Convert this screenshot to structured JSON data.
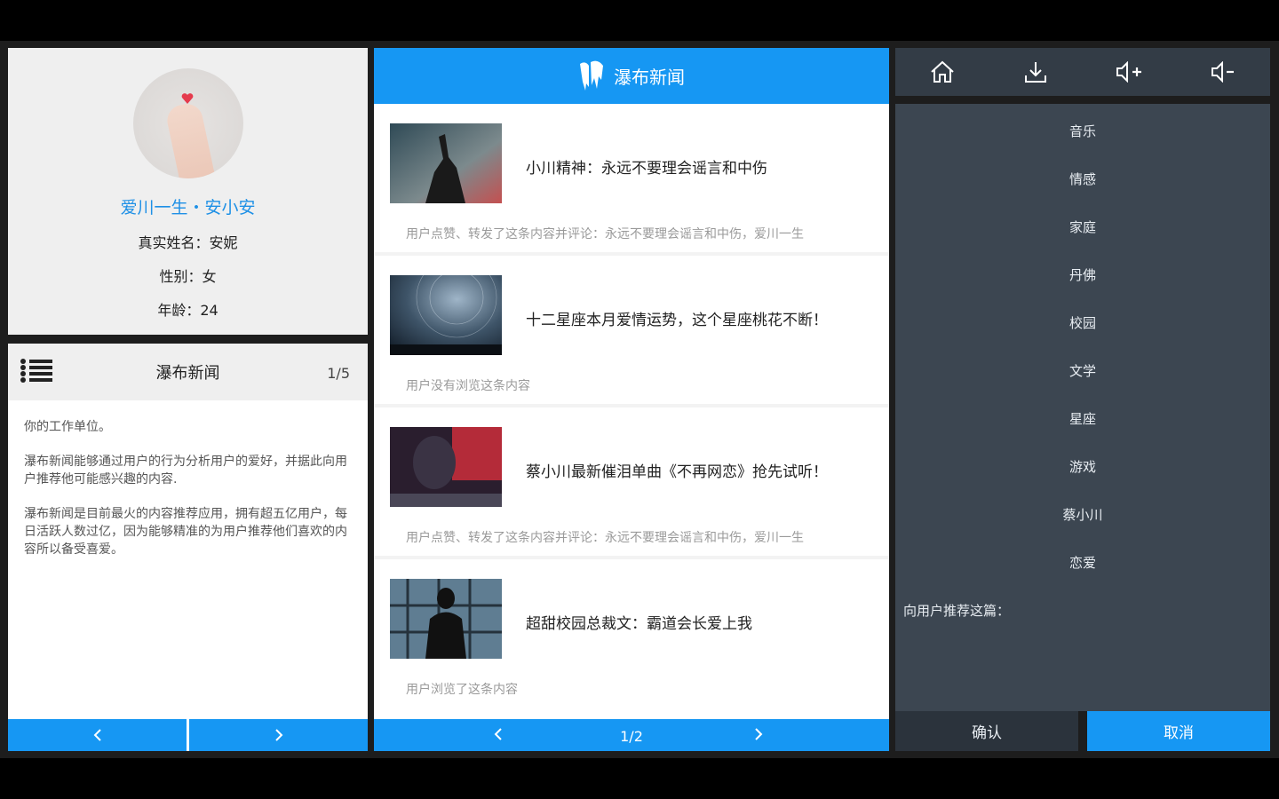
{
  "profile": {
    "nickname": "爱川一生・安小安",
    "real_name": "真实姓名：安妮",
    "gender": "性别：女",
    "age": "年龄：24"
  },
  "text_panel": {
    "title": "瀑布新闻",
    "page": "1/5",
    "paragraphs": [
      "你的工作单位。",
      "瀑布新闻能够通过用户的行为分析用户的爱好，并据此向用户推荐他可能感兴趣的内容.",
      "瀑布新闻是目前最火的内容推荐应用，拥有超五亿用户，每日活跃人数过亿，因为能够精准的为用户推荐他们喜欢的内容所以备受喜爱。"
    ]
  },
  "news": {
    "app_title": "瀑布新闻",
    "items": [
      {
        "title": "小川精神：永远不要理会谣言和中伤",
        "comment": "用户点赞、转发了这条内容并评论：永远不要理会谣言和中伤，爱川一生"
      },
      {
        "title": "十二星座本月爱情运势，这个星座桃花不断！",
        "comment": "用户没有浏览这条内容"
      },
      {
        "title": "蔡小川最新催泪单曲《不再网恋》抢先试听！",
        "comment": "用户点赞、转发了这条内容并评论：永远不要理会谣言和中伤，爱川一生"
      },
      {
        "title": "超甜校园总裁文：霸道会长爱上我",
        "comment": "用户浏览了这条内容"
      }
    ],
    "page": "1/2"
  },
  "toolbar": {
    "icons": [
      "home-icon",
      "download-icon",
      "volume-up-icon",
      "volume-down-icon"
    ]
  },
  "categories": [
    "音乐",
    "情感",
    "家庭",
    "丹佛",
    "校园",
    "文学",
    "星座",
    "游戏",
    "蔡小川",
    "恋爱"
  ],
  "recommend_label": "向用户推荐这篇：",
  "buttons": {
    "confirm": "确认",
    "cancel": "取消"
  },
  "colors": {
    "accent": "#1697f3",
    "nickname": "#1e90e6",
    "dark_panel": "#3c4651"
  }
}
